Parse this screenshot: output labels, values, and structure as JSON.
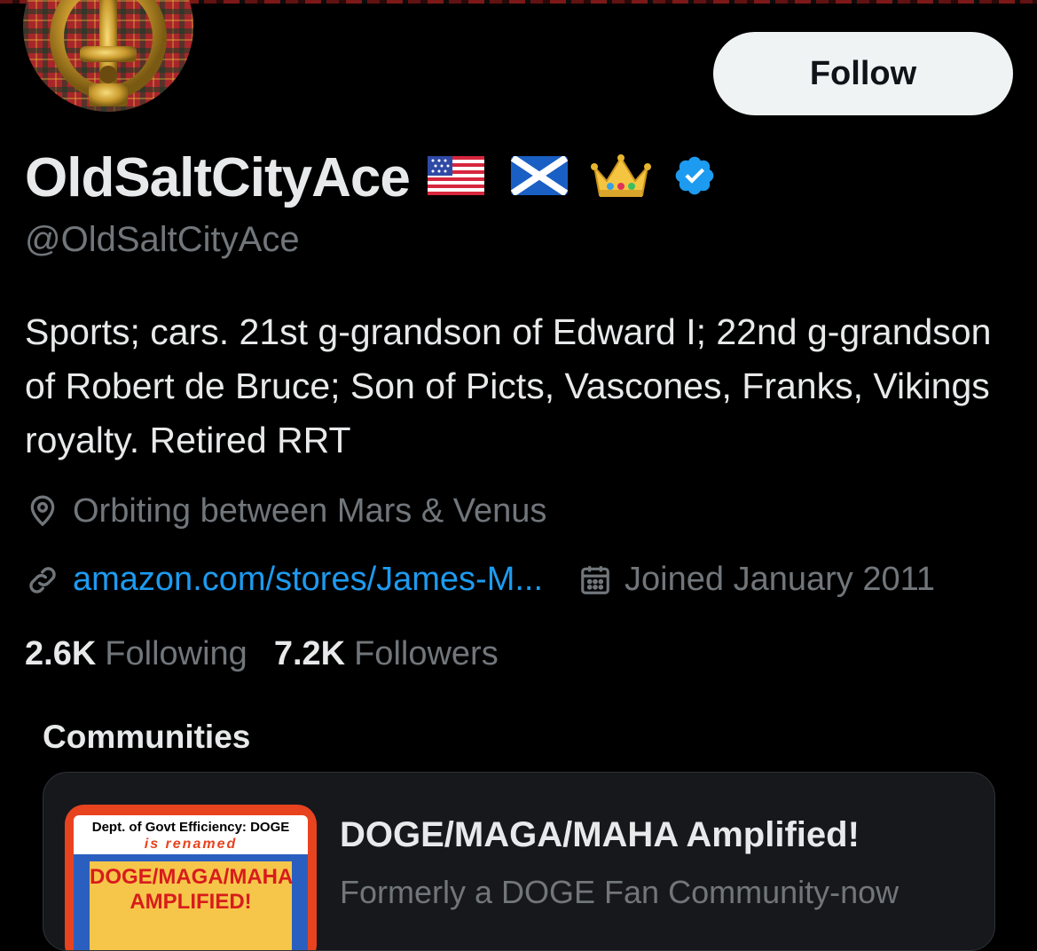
{
  "profile": {
    "follow_label": "Follow",
    "display_name": "OldSaltCityAce",
    "name_emojis": [
      "us-flag",
      "scotland-flag",
      "crown"
    ],
    "verified": true,
    "handle": "@OldSaltCityAce",
    "bio": "Sports; cars. 21st g-grandson of Edward I; 22nd g-grandson of Robert de Bruce; Son of Picts, Vascones, Franks, Vikings royalty. Retired RRT",
    "location": "Orbiting between Mars & Venus",
    "website": "amazon.com/stores/James-M...",
    "joined": "Joined January 2011",
    "following_count": "2.6K",
    "following_label": "Following",
    "followers_count": "7.2K",
    "followers_label": "Followers"
  },
  "communities": {
    "label": "Communities",
    "items": [
      {
        "title": "DOGE/MAGA/MAHA Amplified!",
        "description": "Formerly a DOGE Fan Community-now",
        "thumb_top": "Dept. of Govt Efficiency: DOGE",
        "thumb_renamed": "is renamed",
        "thumb_line1": "DOGE/MAGA/MAHA",
        "thumb_line2": "AMPLIFIED!"
      }
    ]
  },
  "colors": {
    "background": "#000000",
    "primary_text": "#e7e9ea",
    "secondary_text": "#71767b",
    "link": "#1d9bf0",
    "verified_badge": "#1d9bf0",
    "follow_button_bg": "#eff3f4"
  },
  "icons": {
    "location": "location-pin-icon",
    "link": "link-icon",
    "calendar": "calendar-icon",
    "verified": "verified-badge-icon"
  }
}
